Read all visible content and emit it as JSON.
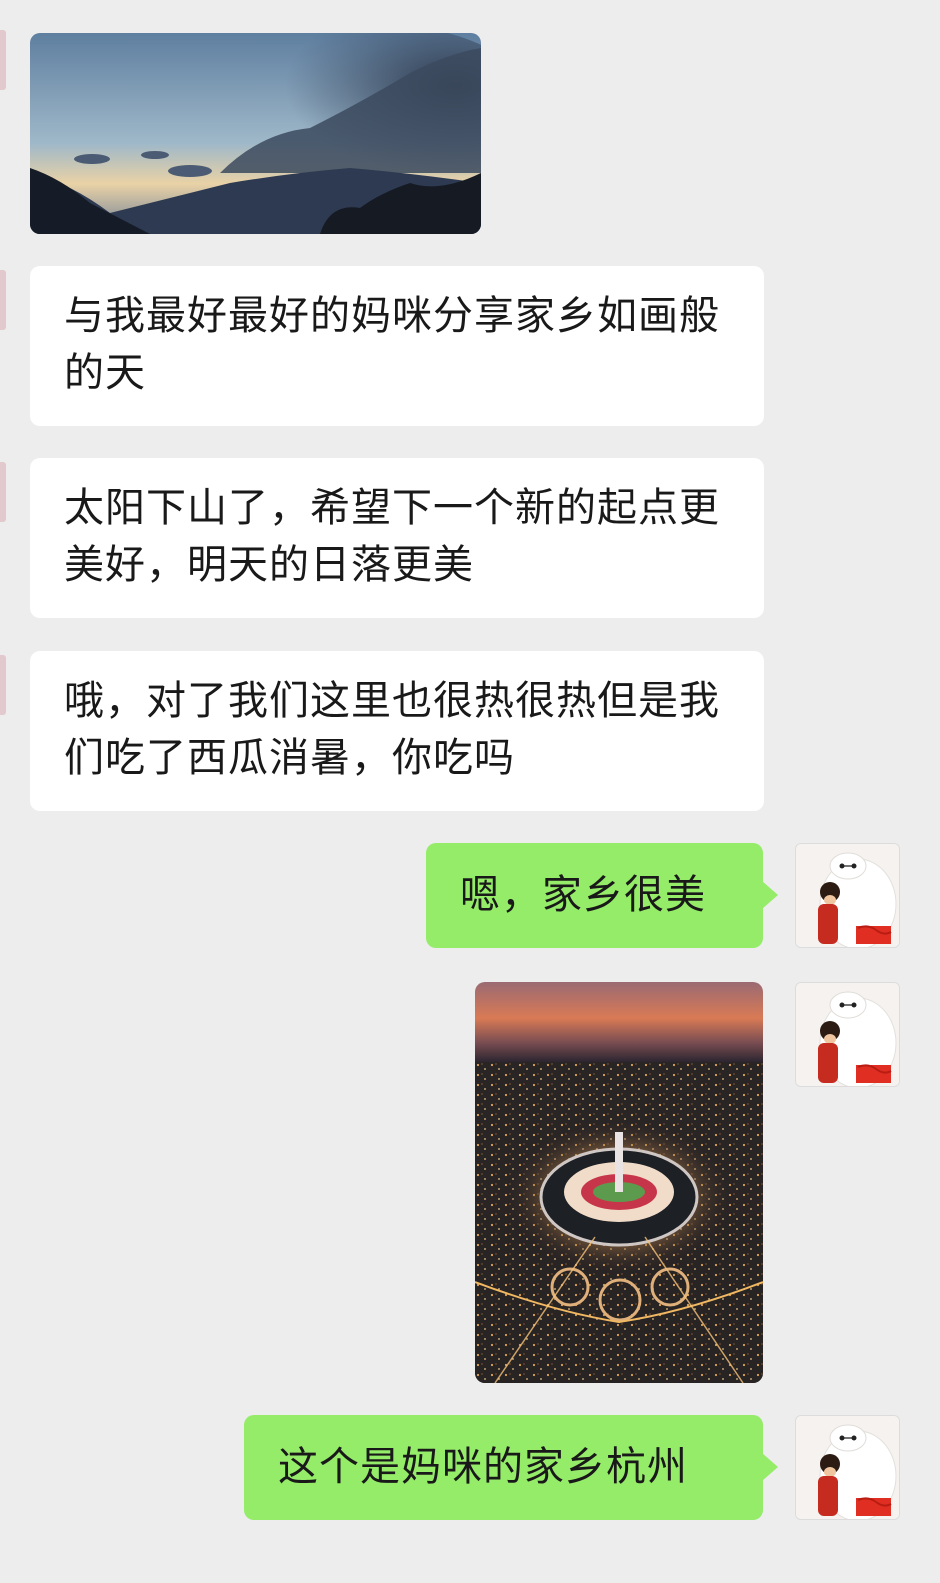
{
  "messages": {
    "in_text_1": "与我最好最好的妈咪分享家乡如画般的天",
    "in_text_2": "太阳下山了，希望下一个新的起点更美好，明天的日落更美",
    "in_text_3": "哦，对了我们这里也很热很热但是我们吃了西瓜消暑，你吃吗",
    "out_text_1": "嗯，家乡很美",
    "out_text_2": "这个是妈咪的家乡杭州"
  },
  "colors": {
    "background": "#ededed",
    "incoming_bubble": "#ffffff",
    "outgoing_bubble": "#95ec69",
    "text": "#191919"
  },
  "icons": {
    "avatar": "white-robot-hug-avatar",
    "flag": "red-flag"
  }
}
